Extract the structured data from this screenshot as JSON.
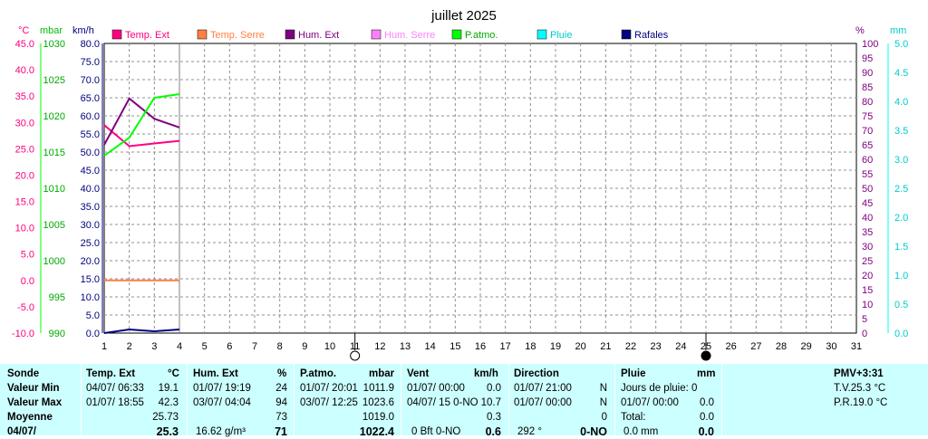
{
  "chart_data": {
    "type": "line",
    "title": "juillet 2025",
    "axis_units": {
      "temp": "°C",
      "pressure": "mbar",
      "wind": "km/h",
      "humidity": "%",
      "rain": "mm"
    },
    "ylim_temp": [
      -10,
      45
    ],
    "ylim_pressure": [
      990,
      1030
    ],
    "ylim_wind": [
      0,
      80
    ],
    "ylim_humidity": [
      0,
      100
    ],
    "ylim_rain": [
      0,
      5
    ],
    "x": [
      1,
      2,
      3,
      4,
      5,
      6,
      7,
      8,
      9,
      10,
      11,
      12,
      13,
      14,
      15,
      16,
      17,
      18,
      19,
      20,
      21,
      22,
      23,
      24,
      25,
      26,
      27,
      28,
      29,
      30,
      31
    ],
    "legend": [
      {
        "name": "Temp. Ext",
        "color": "#ff0080"
      },
      {
        "name": "Temp. Serre",
        "color": "#ff8040"
      },
      {
        "name": "Hum. Ext",
        "color": "#800080"
      },
      {
        "name": "Hum. Serre",
        "color": "#ff80ff"
      },
      {
        "name": "P.atmo.",
        "color": "#00ff00"
      },
      {
        "name": "Pluie",
        "color": "#00ffff"
      },
      {
        "name": "Rafales",
        "color": "#000080"
      }
    ],
    "series": [
      {
        "name": "Temp. Ext",
        "axis": "temp",
        "color": "#ff0080",
        "points": [
          [
            1,
            29.5
          ],
          [
            2,
            25.5
          ],
          [
            3,
            26.0
          ],
          [
            4,
            26.5
          ]
        ]
      },
      {
        "name": "Temp. Serre",
        "axis": "temp",
        "color": "#ff8040",
        "points": [
          [
            1,
            0.0
          ],
          [
            2,
            0.0
          ],
          [
            3,
            0.0
          ],
          [
            4,
            0.0
          ]
        ]
      },
      {
        "name": "Hum. Ext",
        "axis": "humidity",
        "color": "#800080",
        "points": [
          [
            1,
            65
          ],
          [
            2,
            81
          ],
          [
            3,
            74
          ],
          [
            4,
            71
          ]
        ]
      },
      {
        "name": "P.atmo.",
        "axis": "pressure",
        "color": "#00ff00",
        "points": [
          [
            1,
            1014.5
          ],
          [
            2,
            1017.0
          ],
          [
            3,
            1022.5
          ],
          [
            4,
            1023.0
          ]
        ]
      },
      {
        "name": "Rafales",
        "axis": "wind",
        "color": "#000080",
        "points": [
          [
            1,
            0.0
          ],
          [
            2,
            1.0
          ],
          [
            3,
            0.5
          ],
          [
            4,
            1.0
          ]
        ]
      }
    ],
    "moon": {
      "new_moon_day": 25,
      "full_moon_day": 11
    }
  },
  "stats": {
    "headers": {
      "sonde": "Sonde",
      "temp": "Temp. Ext",
      "temp_unit": "°C",
      "hum": "Hum. Ext",
      "hum_unit": "%",
      "patmo": "P.atmo.",
      "patmo_unit": "mbar",
      "vent": "Vent",
      "vent_unit": "km/h",
      "dir": "Direction",
      "pluie": "Pluie",
      "pluie_unit": "mm",
      "pmv": "PMV+3:31"
    },
    "rows": {
      "min_label": "Valeur Min",
      "max_label": "Valeur Max",
      "avg_label": "Moyenne",
      "cur_label": "04/07/"
    },
    "temp": {
      "min_date": "04/07/  06:33",
      "min": "19.1",
      "max_date": "01/07/  18:55",
      "max": "42.3",
      "avg": "25.73",
      "cur": "25.3"
    },
    "hum": {
      "min_date": "01/07/  19:19",
      "min": "24",
      "max_date": "03/07/  04:04",
      "max": "94",
      "avg": "73",
      "cur_extra": "16.62 g/m³",
      "cur": "71"
    },
    "patmo": {
      "min_date": "01/07/  20:01",
      "min": "1011.9",
      "max_date": "03/07/  12:25",
      "max": "1023.6",
      "avg": "1019.0",
      "cur": "1022.4"
    },
    "vent": {
      "min_date": "01/07/  00:00",
      "min": "0.0",
      "max_date": "04/07/  15 0-NO",
      "max": "10.7",
      "avg": "0.3",
      "cur_extra": "0 Bft 0-NO",
      "cur": "0.6"
    },
    "dir": {
      "min_date": "01/07/  21:00",
      "min": "N",
      "max_date": "01/07/  00:00",
      "max": "N",
      "avg": "0",
      "cur_extra": "292 °",
      "cur": "0-NO"
    },
    "pluie": {
      "r1_label": "Jours de pluie: 0",
      "r2_date": "01/07/  00:00",
      "r2_val": "0.0",
      "r3_label": "Total:",
      "r3_val": "0.0",
      "cur_extra": "0.0 mm",
      "cur": "0.0"
    },
    "pmv": {
      "tv": "T.V.25.3 °C",
      "pr": "P.R.19.0 °C"
    }
  }
}
